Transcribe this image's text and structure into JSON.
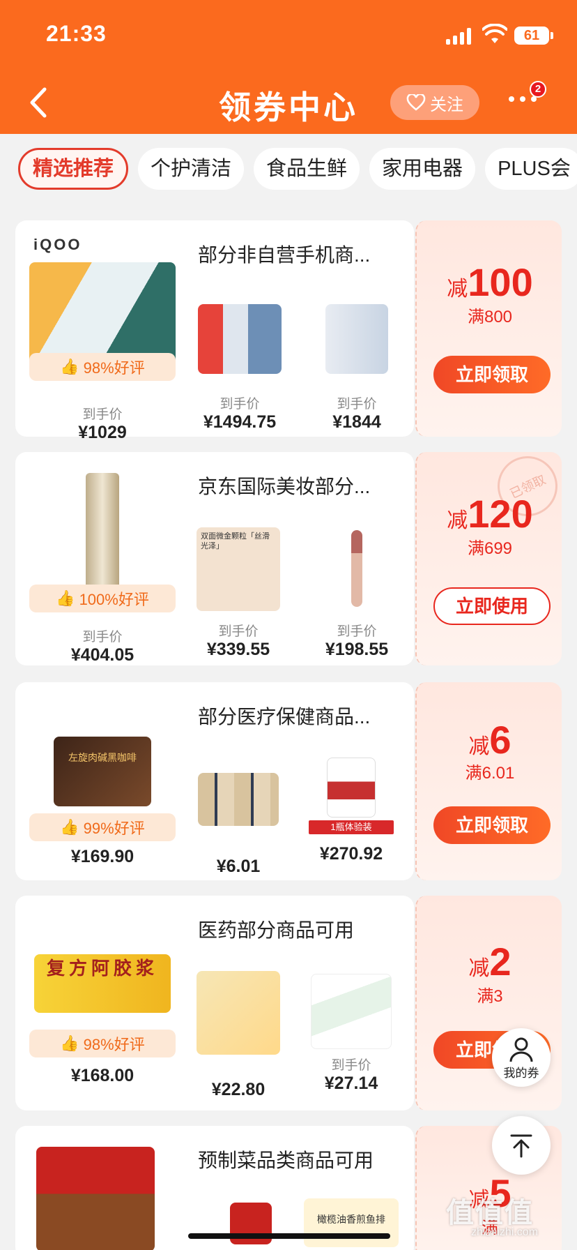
{
  "status": {
    "time": "21:33",
    "battery": "61"
  },
  "header": {
    "title": "领券中心",
    "follow_label": "关注",
    "badge_count": "2"
  },
  "tabs": [
    "精选推荐",
    "个护清洁",
    "食品生鲜",
    "家用电器",
    "PLUS会"
  ],
  "cards": [
    {
      "brand": "iQOO",
      "title": "部分非自营手机商...",
      "rating": "98%好评",
      "products": [
        {
          "label": "到手价",
          "price": "¥1029"
        },
        {
          "label": "到手价",
          "price": "¥1494.75"
        },
        {
          "label": "到手价",
          "price": "¥1844"
        }
      ],
      "discount_prefix": "减",
      "discount": "100",
      "threshold": "满800",
      "button": "立即领取",
      "claimed": false
    },
    {
      "title": "京东国际美妆部分...",
      "rating": "100%好评",
      "products": [
        {
          "label": "到手价",
          "price": "¥404.05"
        },
        {
          "label": "到手价",
          "price": "¥339.55"
        },
        {
          "label": "到手价",
          "price": "¥198.55"
        }
      ],
      "product_text": "双面微金颗粒「丝滑光泽」",
      "discount_prefix": "减",
      "discount": "120",
      "threshold": "满699",
      "button": "立即使用",
      "claimed": true,
      "stamp": "已领取"
    },
    {
      "title": "部分医疗保健商品...",
      "rating": "99%好评",
      "products": [
        {
          "price": "¥169.90"
        },
        {
          "price": "¥6.01"
        },
        {
          "price": "¥270.92"
        }
      ],
      "product_text": "左旋肉碱黑咖啡",
      "product_text_2": "1瓶体验装",
      "discount_prefix": "减",
      "discount": "6",
      "threshold": "满6.01",
      "button": "立即领取",
      "claimed": false
    },
    {
      "title": "医药部分商品可用",
      "rating": "98%好评",
      "products": [
        {
          "price": "¥168.00"
        },
        {
          "price": "¥22.80"
        },
        {
          "label": "到手价",
          "price": "¥27.14"
        }
      ],
      "product_text": "复方阿胶浆",
      "discount_prefix": "减",
      "discount": "2",
      "threshold": "满3",
      "button": "立即领取",
      "claimed": false
    },
    {
      "title": "预制菜品类商品可用",
      "discount_prefix": "减",
      "discount": "5",
      "threshold": "满",
      "product_text": "橄榄油香煎鱼排"
    }
  ],
  "floating": {
    "my_coupons": "我的券"
  },
  "watermark": {
    "main": "值值值",
    "sub": "zhizhizhi.com"
  },
  "colors": {
    "header": "#fb6a1e",
    "accent": "#e8271e",
    "background": "#f2f2f2"
  }
}
